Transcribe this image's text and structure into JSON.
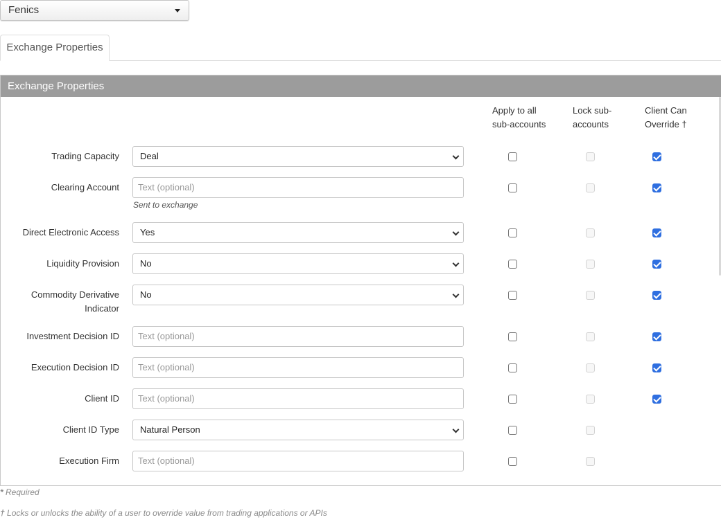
{
  "exchange_select": {
    "value": "Fenics"
  },
  "tabs": [
    {
      "label": "Exchange Properties"
    }
  ],
  "panel": {
    "title": "Exchange Properties",
    "columns": {
      "apply_all": [
        "Apply to all",
        "sub-accounts"
      ],
      "lock": [
        "Lock sub-",
        "accounts"
      ],
      "override": [
        "Client Can",
        "Override †"
      ]
    }
  },
  "rows": [
    {
      "label": [
        "Trading Capacity"
      ],
      "type": "select",
      "value": "Deal",
      "apply_all": false,
      "lock_disabled": true,
      "client_override": true
    },
    {
      "label": [
        "Clearing Account"
      ],
      "type": "input",
      "placeholder": "Text (optional)",
      "hint": "Sent to exchange",
      "apply_all": false,
      "lock_disabled": true,
      "client_override": true
    },
    {
      "label": [
        "Direct Electronic Access"
      ],
      "type": "select",
      "value": "Yes",
      "apply_all": false,
      "lock_disabled": true,
      "client_override": true
    },
    {
      "label": [
        "Liquidity Provision"
      ],
      "type": "select",
      "value": "No",
      "apply_all": false,
      "lock_disabled": true,
      "client_override": true
    },
    {
      "label": [
        "Commodity Derivative",
        "Indicator"
      ],
      "type": "select",
      "value": "No",
      "apply_all": false,
      "lock_disabled": true,
      "client_override": true
    },
    {
      "label": [
        "Investment Decision ID"
      ],
      "type": "input",
      "placeholder": "Text (optional)",
      "apply_all": false,
      "lock_disabled": true,
      "client_override": true
    },
    {
      "label": [
        "Execution Decision ID"
      ],
      "type": "input",
      "placeholder": "Text (optional)",
      "apply_all": false,
      "lock_disabled": true,
      "client_override": true
    },
    {
      "label": [
        "Client ID"
      ],
      "type": "input",
      "placeholder": "Text (optional)",
      "apply_all": false,
      "lock_disabled": true,
      "client_override": true
    },
    {
      "label": [
        "Client ID Type"
      ],
      "type": "select",
      "value": "Natural Person",
      "apply_all": false,
      "lock_disabled": true,
      "client_override": null
    },
    {
      "label": [
        "Execution Firm"
      ],
      "type": "input",
      "placeholder": "Text (optional)",
      "apply_all": false,
      "lock_disabled": true,
      "client_override": null
    }
  ],
  "footnotes": {
    "required_mark": "*",
    "required": "Required",
    "dagger_mark": "†",
    "dagger": "Locks or unlocks the ability of a user to override value from trading applications or APIs"
  },
  "colors": {
    "header_bg": "#9c9c9c",
    "checkbox_on": "#2f6fe0"
  }
}
